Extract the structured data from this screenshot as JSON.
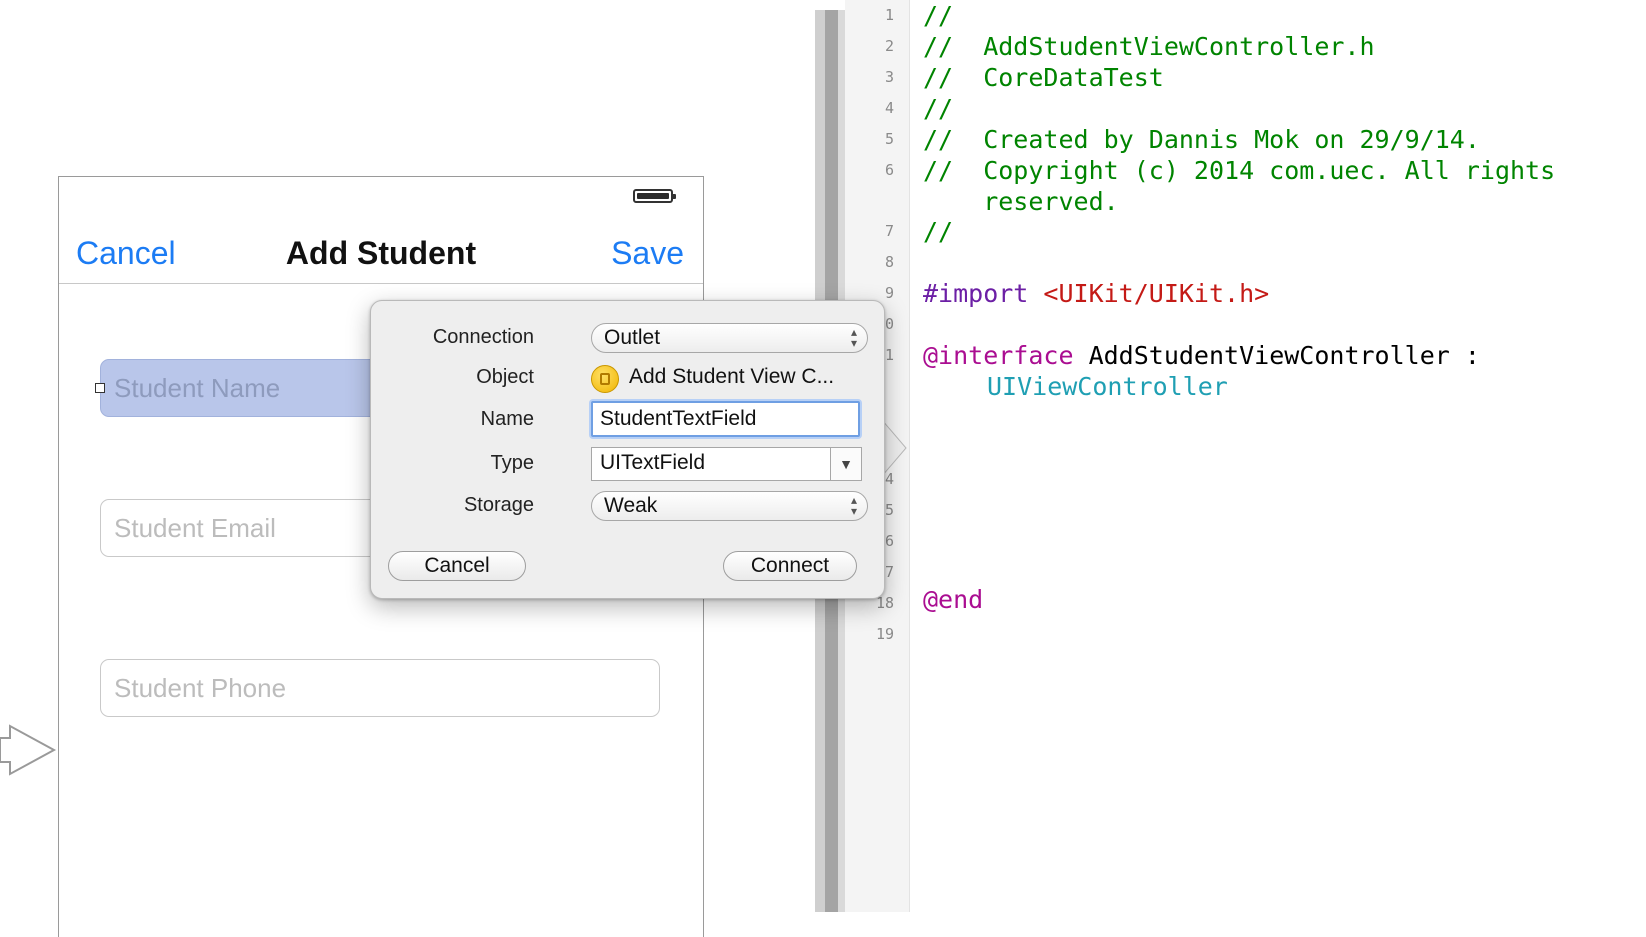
{
  "storyboard": {
    "nav": {
      "cancel": "Cancel",
      "title": "Add Student",
      "save": "Save"
    },
    "fields": {
      "name_placeholder": "Student Name",
      "email_placeholder": "Student Email",
      "phone_placeholder": "Student Phone"
    }
  },
  "popover": {
    "labels": {
      "connection": "Connection",
      "object": "Object",
      "name": "Name",
      "type": "Type",
      "storage": "Storage"
    },
    "connection_value": "Outlet",
    "object_value": "Add Student View C...",
    "name_value": "StudentTextField",
    "type_value": "UITextField",
    "storage_value": "Weak",
    "cancel_label": "Cancel",
    "connect_label": "Connect",
    "icons": {
      "object": "view-controller-icon",
      "updown": "updown-arrows-icon",
      "dropdown": "triangle-down-icon"
    }
  },
  "editor": {
    "line_numbers": [
      "1",
      "2",
      "3",
      "4",
      "5",
      "6",
      "7",
      "8",
      "9",
      "0",
      "1",
      "4",
      "5",
      "6",
      "7",
      "18",
      "19"
    ],
    "lines": {
      "l1": "//",
      "l2": "//  AddStudentViewController.h",
      "l3": "//  CoreDataTest",
      "l4": "//",
      "l5": "//  Created by Dannis Mok on 29/9/14.",
      "l6": "//  Copyright (c) 2014 com.uec. All rights",
      "l6b": "    reserved.",
      "l7": "//",
      "import_kw": "#import",
      "import_path": "<UIKit/UIKit.h>",
      "interface_kw": "@interface",
      "interface_name": "AddStudentViewController :",
      "superclass": "UIViewController",
      "end_kw": "@end"
    }
  },
  "colors": {
    "ios_blue": "#1c7cf4",
    "comment_green": "#008400",
    "keyword_purple": "#aa0d91",
    "string_red": "#c41a16",
    "type_teal": "#1f9fb3"
  }
}
